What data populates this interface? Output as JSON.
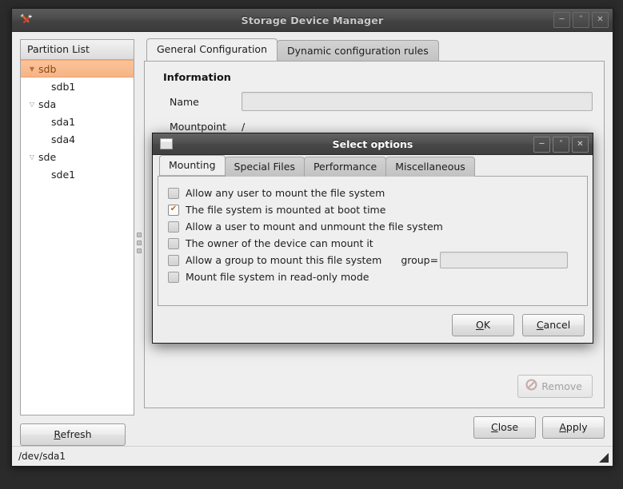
{
  "main_window": {
    "title": "Storage Device Manager",
    "app_icon": "tools-icon",
    "window_controls": [
      {
        "name": "minimize",
        "glyph": "─"
      },
      {
        "name": "maximize",
        "glyph": "˄"
      },
      {
        "name": "close",
        "glyph": "✕"
      }
    ],
    "partition_list": {
      "header": "Partition List",
      "items": [
        {
          "label": "sdb",
          "type": "disk",
          "expander": "▼",
          "selected": true
        },
        {
          "label": "sdb1",
          "type": "partition",
          "expander": "",
          "selected": false
        },
        {
          "label": "sda",
          "type": "disk",
          "expander": "▽",
          "selected": false
        },
        {
          "label": "sda1",
          "type": "partition",
          "expander": "",
          "selected": false
        },
        {
          "label": "sda4",
          "type": "partition",
          "expander": "",
          "selected": false
        },
        {
          "label": "sde",
          "type": "disk",
          "expander": "▽",
          "selected": false
        },
        {
          "label": "sde1",
          "type": "partition",
          "expander": "",
          "selected": false
        }
      ]
    },
    "refresh_button": "Refresh",
    "refresh_mnemonic": "R",
    "tabs": [
      {
        "label": "General Configuration",
        "active": true
      },
      {
        "label": "Dynamic configuration rules",
        "active": false
      }
    ],
    "information": {
      "section_title": "Information",
      "name_label": "Name",
      "name_value": "",
      "mountpoint_label": "Mountpoint",
      "mountpoint_value": "/"
    },
    "remove_button": {
      "label": "Remove",
      "icon": "no-entry-icon",
      "disabled": true
    },
    "footer_buttons": [
      {
        "label": "Close",
        "mnemonic": "C"
      },
      {
        "label": "Apply",
        "mnemonic": "A"
      }
    ],
    "statusbar": "/dev/sda1"
  },
  "dialog": {
    "title": "Select options",
    "icon": "window-icon",
    "window_controls": [
      {
        "name": "minimize",
        "glyph": "─"
      },
      {
        "name": "maximize",
        "glyph": "˄"
      },
      {
        "name": "close",
        "glyph": "✕"
      }
    ],
    "tabs": [
      {
        "label": "Mounting",
        "active": true
      },
      {
        "label": "Special Files",
        "active": false
      },
      {
        "label": "Performance",
        "active": false
      },
      {
        "label": "Miscellaneous",
        "active": false
      }
    ],
    "options": [
      {
        "label": "Allow any user to mount the file system",
        "checked": false
      },
      {
        "label": "The file system is mounted at boot time",
        "checked": true
      },
      {
        "label": "Allow a user to mount and unmount the file system",
        "checked": false
      },
      {
        "label": "The owner of the device can mount it",
        "checked": false
      },
      {
        "label": "Allow a group to mount this file system",
        "checked": false
      },
      {
        "label": "Mount file system in read-only mode",
        "checked": false
      }
    ],
    "group_field": {
      "label": "group=",
      "value": ""
    },
    "buttons": [
      {
        "label": "OK",
        "mnemonic": "O"
      },
      {
        "label": "Cancel",
        "mnemonic": "C"
      }
    ]
  },
  "colors": {
    "selection_bg": "#f6b486",
    "selection_text": "#8a4a12",
    "checkmark": "#c0651b",
    "window_bg": "#ededed",
    "panel_bg": "#efefef",
    "titlebar": "#4a4a4a"
  }
}
